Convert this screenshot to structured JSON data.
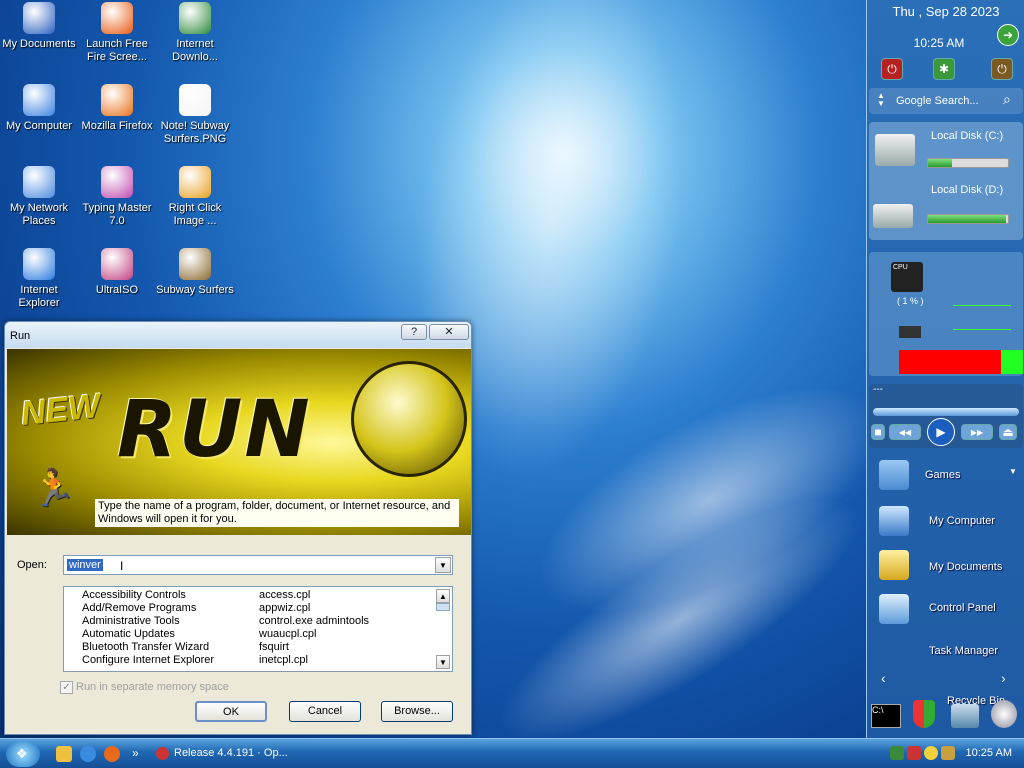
{
  "desktop_icons": [
    {
      "label": "My Documents",
      "icon": "documents-icon"
    },
    {
      "label": "Launch Free Fire Scree...",
      "icon": "fire-icon"
    },
    {
      "label": "Internet Downlo...",
      "icon": "download-manager-icon"
    },
    {
      "label": "My Computer",
      "icon": "computer-icon"
    },
    {
      "label": "Mozilla Firefox",
      "icon": "firefox-icon"
    },
    {
      "label": "Note! Subway Surfers.PNG",
      "icon": "image-file-icon"
    },
    {
      "label": "My Network Places",
      "icon": "network-icon"
    },
    {
      "label": "Typing Master 7.0",
      "icon": "typing-master-icon"
    },
    {
      "label": "Right Click Image ...",
      "icon": "gear-icon"
    },
    {
      "label": "Internet Explorer",
      "icon": "internet-explorer-icon"
    },
    {
      "label": "UltraISO",
      "icon": "disc-icon"
    },
    {
      "label": "Subway Surfers",
      "icon": "game-icon"
    }
  ],
  "sidebar": {
    "date": "Thu , Sep 28 2023",
    "time": "10:25 AM",
    "search_placeholder": "Google Search...",
    "disks": [
      {
        "label": "Local Disk (C:)",
        "used_fraction": 0.3
      },
      {
        "label": "Local Disk (D:)",
        "used_fraction": 0.98
      }
    ],
    "cpu_label": "CPU",
    "cpu_percent": "( 1 % )",
    "media_title": "---",
    "links": [
      "Games",
      "My Computer",
      "My Documents",
      "Control Panel",
      "Task Manager",
      "Recycle Bin"
    ]
  },
  "run_dialog": {
    "title": "Run",
    "help": "?",
    "close": "✕",
    "banner_new": "NEW",
    "banner_run": "RUN",
    "description": "Type the name of a program, folder, document, or Internet resource, and Windows will open it for you.",
    "open_label": "Open:",
    "open_value": "winver",
    "list": [
      {
        "name": "Accessibility Controls",
        "cmd": "access.cpl"
      },
      {
        "name": "Add/Remove Programs",
        "cmd": "appwiz.cpl"
      },
      {
        "name": "Administrative Tools",
        "cmd": "control.exe admintools"
      },
      {
        "name": "Automatic Updates",
        "cmd": "wuaucpl.cpl"
      },
      {
        "name": "Bluetooth Transfer Wizard",
        "cmd": "fsquirt"
      },
      {
        "name": "Configure Internet Explorer",
        "cmd": "inetcpl.cpl"
      }
    ],
    "separate_memory_label": "Run in separate memory space",
    "ok_label": "OK",
    "cancel_label": "Cancel",
    "browse_label": "Browse..."
  },
  "taskbar": {
    "overflow": "»",
    "task_label": "Release 4.4.191 · Op...",
    "clock": "10:25 AM"
  }
}
